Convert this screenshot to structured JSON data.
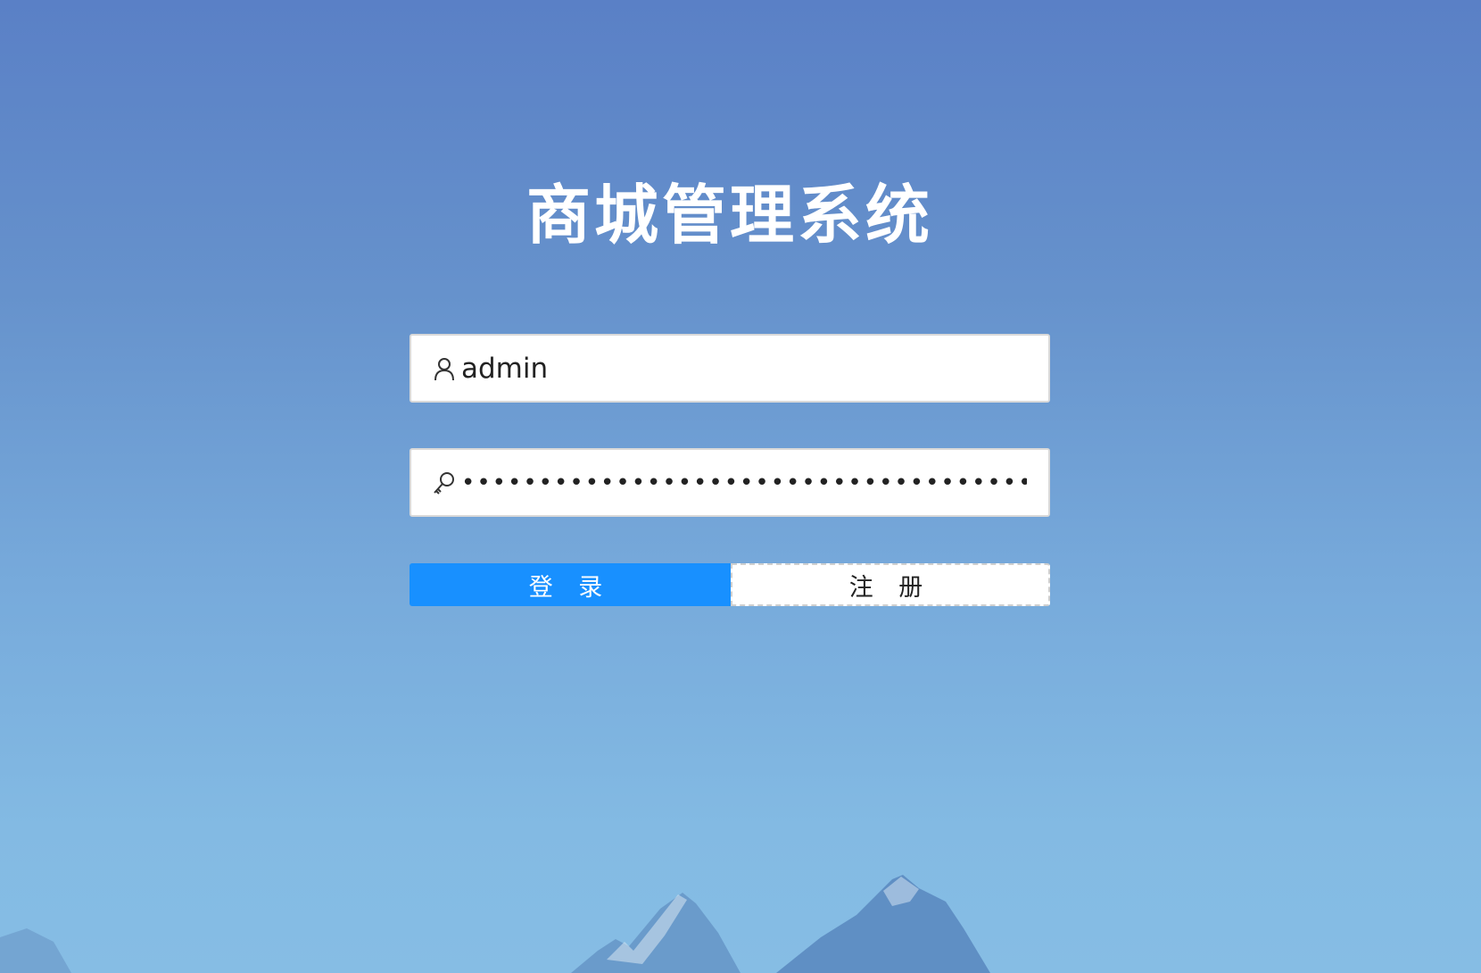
{
  "app": {
    "title": "商城管理系统"
  },
  "form": {
    "username": {
      "value": "admin",
      "icon": "user-icon"
    },
    "password": {
      "value": "••••••••••••••••••••••••••••••••••••••••••••",
      "icon": "key-icon"
    },
    "buttons": {
      "login_label": "登 录",
      "register_label": "注 册"
    }
  },
  "colors": {
    "background_top": "#5a80c6",
    "background_bottom": "#86bde4",
    "primary": "#1890ff",
    "title_text": "#ffffff"
  }
}
